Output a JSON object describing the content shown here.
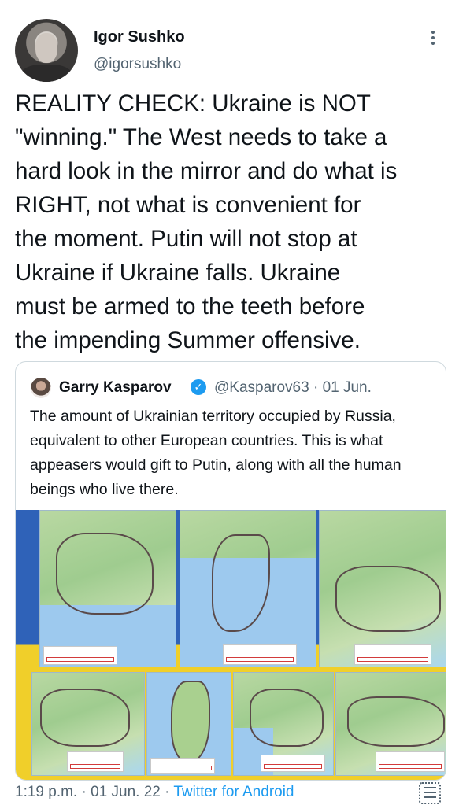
{
  "author": {
    "name": "Igor Sushko",
    "handle": "@igorsushko",
    "avatar_icon": "user-avatar"
  },
  "tweet": {
    "text": "REALITY CHECK: Ukraine is NOT\n\"winning.\" The West needs to take a\nhard look in the mirror and do what is\nRIGHT, not what is convenient for\nthe moment. Putin will not stop at\nUkraine if Ukraine falls. Ukraine\nmust be armed to the teeth before\nthe impending Summer offensive."
  },
  "quoted_tweet": {
    "name": "Garry Kasparov",
    "verified_icon": "verified-badge-icon",
    "handle_date": "@Kasparov63 · 01 Jun.",
    "text": "The amount of Ukrainian territory occupied by Russia, equivalent to other European countries. This is what appeasers would gift to Putin, along with all the human beings who live there."
  },
  "footer": {
    "time_date": "1:19 p.m. · 01 Jun. 22 · ",
    "app": "Twitter for Android"
  },
  "colors": {
    "accent": "#1d9bf0",
    "secondary_text": "#536471",
    "flag_blue": "#2f62b8",
    "flag_yellow": "#f0cf2a"
  }
}
